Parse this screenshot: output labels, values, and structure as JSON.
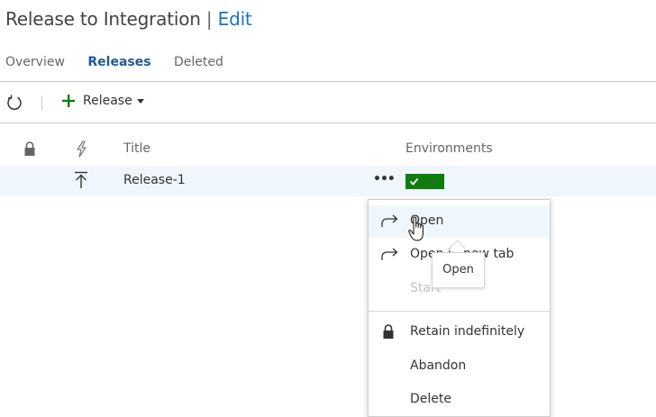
{
  "header": {
    "title": "Release to Integration",
    "separator": "|",
    "edit_link": "Edit"
  },
  "tabs": [
    {
      "label": "Overview",
      "active": false
    },
    {
      "label": "Releases",
      "active": true
    },
    {
      "label": "Deleted",
      "active": false
    }
  ],
  "toolbar": {
    "refresh_icon": "refresh-icon",
    "add_icon": "plus-icon",
    "release_label": "Release"
  },
  "table": {
    "columns": [
      "Title",
      "Environments"
    ],
    "column_icons": [
      "lock-icon",
      "lightning-icon"
    ],
    "rows": [
      {
        "title": "Release-1",
        "row_icon": "deploy-up-icon",
        "more": "•••",
        "environment_status": "succeeded",
        "environment_color": "#107c10"
      }
    ]
  },
  "context_menu": {
    "items": [
      {
        "label": "Open",
        "icon": "redirect-arrow-icon",
        "state": "hover"
      },
      {
        "label": "Open in new tab",
        "icon": "redirect-arrow-icon",
        "state": "normal"
      },
      {
        "label": "Start",
        "icon": "",
        "state": "disabled"
      },
      {
        "label": "Retain indefinitely",
        "icon": "lock-icon",
        "state": "normal"
      },
      {
        "label": "Abandon",
        "icon": "",
        "state": "normal"
      },
      {
        "label": "Delete",
        "icon": "",
        "state": "normal"
      }
    ]
  },
  "tooltip": {
    "text": "Open"
  },
  "colors": {
    "accent": "#1b73c6",
    "active_tab": "#1e5a97",
    "success": "#107c10",
    "row_highlight": "#eff6fc"
  }
}
